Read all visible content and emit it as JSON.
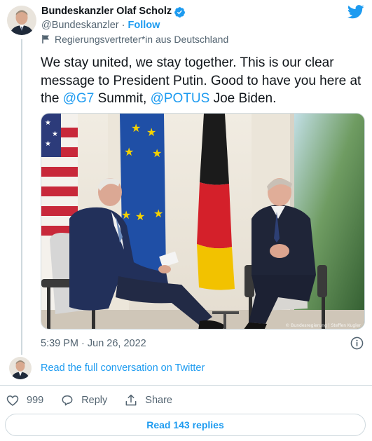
{
  "author": {
    "name": "Bundeskanzler Olaf Scholz",
    "handle": "@Bundeskanzler",
    "separator": " · ",
    "follow_label": "Follow",
    "affiliation_label": "Regierungsvertreter*in aus Deutschland",
    "verified_icon": "verified-badge-icon",
    "flag_icon": "flag-icon"
  },
  "tweet": {
    "text_1": "We stay united, we stay together. This is our clear message to President Putin. Good to have you here at the ",
    "mention_1": "@G7",
    "text_2": " Summit, ",
    "mention_2": "@POTUS",
    "text_3": " Joe Biden."
  },
  "photo": {
    "credit": "© Bundesregierung | Steffen Kugler"
  },
  "meta": {
    "timestamp": "5:39 PM · Jun 26, 2022",
    "info_icon": "info-icon"
  },
  "conversation": {
    "link_label": "Read the full conversation on Twitter"
  },
  "actions": {
    "like_count": "999",
    "reply_label": "Reply",
    "share_label": "Share"
  },
  "replies_button": {
    "label": "Read 143 replies"
  },
  "colors": {
    "accent": "#1d9bf0",
    "text": "#0f1419",
    "secondary": "#536471",
    "border": "#cfd9de"
  }
}
